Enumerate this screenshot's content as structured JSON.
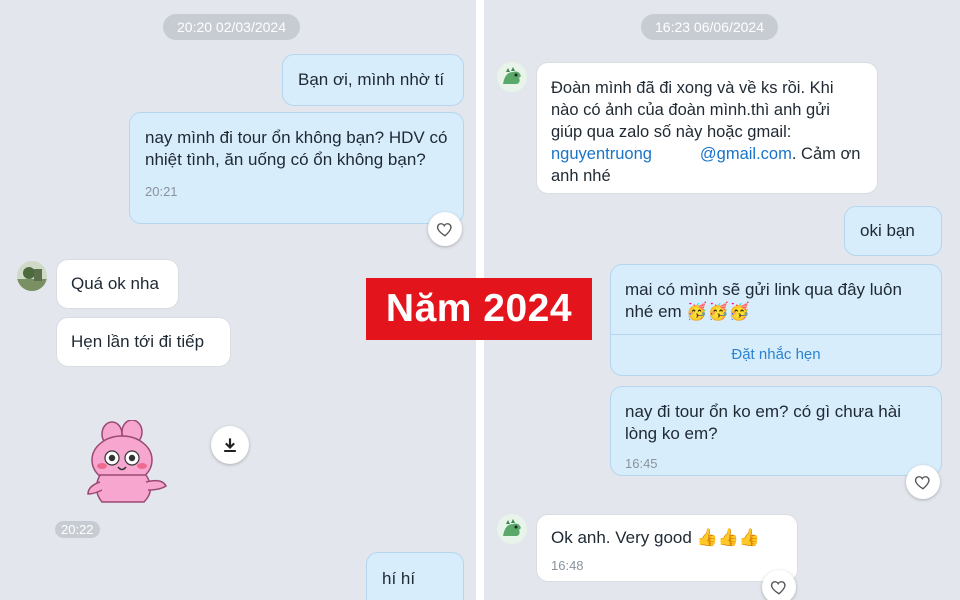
{
  "left": {
    "date_stamp": "20:20 02/03/2024",
    "messages": [
      {
        "dir": "out",
        "text": "Bạn ơi, mình nhờ tí"
      },
      {
        "dir": "out",
        "text": "nay mình đi tour ổn không bạn? HDV có nhiệt tình, ăn uống có ổn không bạn?",
        "time": "20:21"
      },
      {
        "dir": "in",
        "text": "Quá ok nha"
      },
      {
        "dir": "in",
        "text": "Hẹn lần tới đi tiếp"
      },
      {
        "dir": "in",
        "type": "sticker",
        "time": "20:22"
      },
      {
        "dir": "out",
        "text": "hí hí"
      }
    ]
  },
  "right": {
    "date_stamp": "16:23 06/06/2024",
    "messages": [
      {
        "dir": "in",
        "text_parts": [
          "Đoàn mình đã đi xong và về ks rồi. Khi nào có ảnh của đoàn mình.thì anh gửi giúp qua zalo số này hoặc gmail: ",
          "nguyentruong",
          "@gmail.com",
          ". Cảm ơn anh nhé"
        ]
      },
      {
        "dir": "out",
        "text": "oki bạn"
      },
      {
        "dir": "out",
        "text": "mai có mình sẽ gửi link qua đây luôn nhé em 🥳🥳🥳",
        "action": "Đặt nhắc hẹn"
      },
      {
        "dir": "out",
        "text": "nay đi tour ổn ko em? có gì chưa hài lòng ko em?",
        "time": "16:45"
      },
      {
        "dir": "in",
        "text": "Ok anh. Very good 👍👍👍",
        "time": "16:48"
      }
    ]
  },
  "banner": "Năm 2024",
  "colors": {
    "outgoing_bubble": "#d7edfb",
    "incoming_bubble": "#ffffff",
    "background": "#e3e7ed",
    "banner": "#e4141c",
    "link": "#1a73c9"
  },
  "icons": {
    "reaction": "heart-outline-icon",
    "download": "download-icon",
    "avatar": "dinosaur-avatar-icon"
  }
}
